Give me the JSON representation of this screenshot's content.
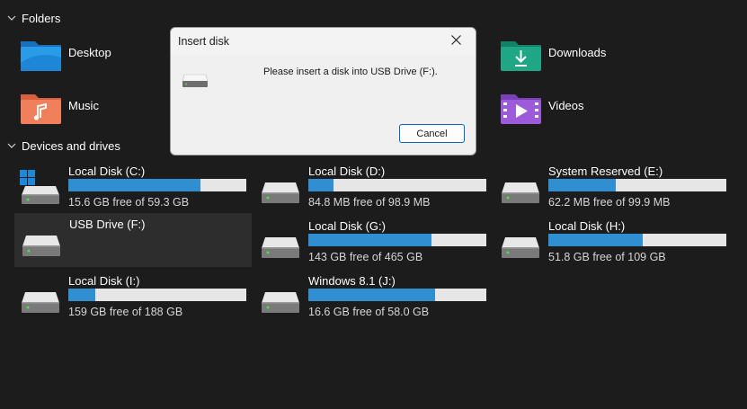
{
  "sections": {
    "folders": "Folders",
    "devices": "Devices and drives"
  },
  "folders": [
    {
      "label": "Desktop",
      "icon": "desktop-folder-icon"
    },
    {
      "label": "Downloads",
      "icon": "downloads-folder-icon"
    },
    {
      "label": "Music",
      "icon": "music-folder-icon"
    },
    {
      "label": "Videos",
      "icon": "videos-folder-icon"
    }
  ],
  "drives": [
    {
      "name": "Local Disk (C:)",
      "free": "15.6 GB free of 59.3 GB",
      "used_fraction": 0.74
    },
    {
      "name": "Local Disk (D:)",
      "free": "84.8 MB free of 98.9 MB",
      "used_fraction": 0.14
    },
    {
      "name": "System Reserved (E:)",
      "free": "62.2 MB free of 99.9 MB",
      "used_fraction": 0.38
    },
    {
      "name": "USB Drive (F:)",
      "free": "",
      "used_fraction": null
    },
    {
      "name": "Local Disk (G:)",
      "free": "143 GB free of 465 GB",
      "used_fraction": 0.69
    },
    {
      "name": "Local Disk (H:)",
      "free": "51.8 GB free of 109 GB",
      "used_fraction": 0.53
    },
    {
      "name": "Local Disk (I:)",
      "free": "159 GB free of 188 GB",
      "used_fraction": 0.15
    },
    {
      "name": "Windows 8.1 (J:)",
      "free": "16.6 GB free of 58.0 GB",
      "used_fraction": 0.71
    }
  ],
  "dialog": {
    "title": "Insert disk",
    "message": "Please insert a disk into USB Drive (F:).",
    "cancel_label": "Cancel"
  },
  "colors": {
    "background": "#1c1c1c",
    "bar_fill": "#2f8fd1",
    "bar_track": "#e6e6e6",
    "dialog_bg": "#f0f0f0",
    "button_border": "#0067c0"
  }
}
